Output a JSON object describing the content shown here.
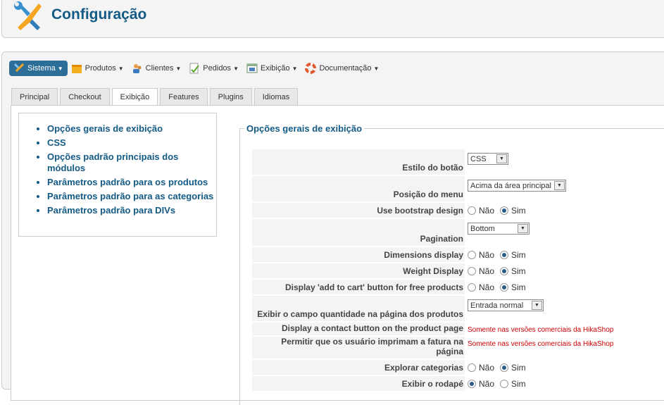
{
  "header": {
    "title": "Configuração",
    "icon": "tools-icon"
  },
  "menu": [
    {
      "label": "Sistema",
      "icon": "tools-icon",
      "active": true
    },
    {
      "label": "Produtos",
      "icon": "box-icon"
    },
    {
      "label": "Clientes",
      "icon": "users-icon"
    },
    {
      "label": "Pedidos",
      "icon": "orders-icon"
    },
    {
      "label": "Exibição",
      "icon": "display-icon"
    },
    {
      "label": "Documentação",
      "icon": "lifebuoy-icon"
    }
  ],
  "tabs": [
    "Principal",
    "Checkout",
    "Exibição",
    "Features",
    "Plugins",
    "Idiomas"
  ],
  "active_tab": "Exibição",
  "toc": [
    "Opções gerais de exibição",
    "CSS",
    "Opções padrão principais dos módulos",
    "Parâmetros padrão para os produtos",
    "Parâmetros padrão para as categorias",
    "Parâmetros padrão para DIVs"
  ],
  "section": {
    "title": "Opções gerais de exibição"
  },
  "radio": {
    "no": "Não",
    "yes": "Sim"
  },
  "rows": [
    {
      "label": "Estilo do botão",
      "type": "select",
      "value": "CSS"
    },
    {
      "label": "Posição do menu",
      "type": "select",
      "value": "Acima da área principal"
    },
    {
      "label": "Use bootstrap design",
      "type": "radio",
      "value": "Sim"
    },
    {
      "label": "Pagination",
      "type": "select",
      "value": "Bottom"
    },
    {
      "label": "Dimensions display",
      "type": "radio",
      "value": "Sim"
    },
    {
      "label": "Weight Display",
      "type": "radio",
      "value": "Sim"
    },
    {
      "label": "Display 'add to cart' button for free products",
      "type": "radio",
      "value": "Sim"
    },
    {
      "label": "Exibir o campo quantidade na página dos produtos",
      "type": "select",
      "value": "Entrada normal"
    },
    {
      "label": "Display a contact button on the product page",
      "type": "text",
      "value": "Somente nas versões comerciais da HikaShop"
    },
    {
      "label": "Permitir que os usuário imprimam a fatura na página",
      "type": "text",
      "value": "Somente nas versões comerciais da HikaShop"
    },
    {
      "label": "Explorar categorias",
      "type": "radio",
      "value": "Sim"
    },
    {
      "label": "Exibir o rodapé",
      "type": "radio",
      "value": "Não"
    }
  ]
}
